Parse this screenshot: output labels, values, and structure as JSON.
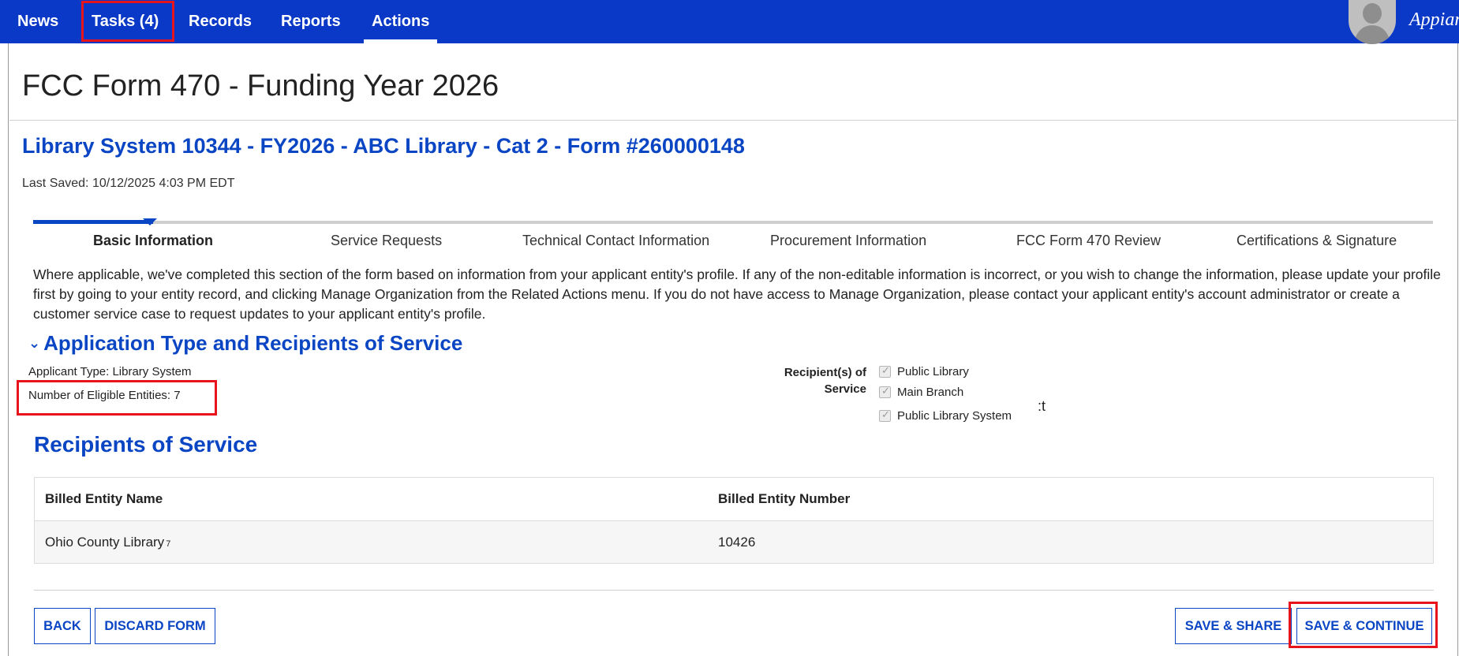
{
  "nav": {
    "items": [
      {
        "label": "News"
      },
      {
        "label": "Tasks (4)"
      },
      {
        "label": "Records"
      },
      {
        "label": "Reports"
      },
      {
        "label": "Actions"
      }
    ],
    "brand": "Appian"
  },
  "page": {
    "title": "FCC Form 470 - Funding Year 2026",
    "subtitle": "Library System 10344 - FY2026 - ABC Library - Cat 2 - Form #260000148",
    "last_saved": "Last Saved: 10/12/2025 4:03 PM EDT"
  },
  "steps": [
    {
      "label": "Basic Information"
    },
    {
      "label": "Service Requests"
    },
    {
      "label": "Technical Contact Information"
    },
    {
      "label": "Procurement Information"
    },
    {
      "label": "FCC Form 470 Review"
    },
    {
      "label": "Certifications & Signature"
    }
  ],
  "intro": "Where applicable, we've completed this section of the form based on information from your applicant entity's profile.  If any of the non-editable information is incorrect, or you wish to change the information, please update your profile first by going to your entity record, and clicking Manage Organization from the Related Actions menu.  If you do not have access to Manage Organization, please contact your applicant entity's account administrator or create a customer service case to request updates to your applicant entity's profile.",
  "application_section": {
    "chevron": "⌄",
    "title": "Application Type and Recipients of Service",
    "applicant_type": "Applicant Type: Library System",
    "eligible_entities": "Number of Eligible Entities: 7",
    "recipients_label": "Recipient(s) of Service",
    "recipients": [
      {
        "label": "Public Library",
        "checked": true
      },
      {
        "label": "Main Branch",
        "checked": true
      },
      {
        "label": "Public Library System",
        "checked": true
      }
    ],
    "stray_text": ":t"
  },
  "recipients_table": {
    "title": "Recipients of Service",
    "columns": [
      "Billed Entity Name",
      "Billed Entity Number"
    ],
    "rows": [
      {
        "name": "Ohio County Library",
        "name_marker": "7",
        "number": "10426"
      }
    ]
  },
  "buttons": {
    "back": "BACK",
    "discard": "DISCARD FORM",
    "save_share": "SAVE & SHARE",
    "save_continue": "SAVE & CONTINUE"
  },
  "colors": {
    "nav_bg": "#0a38c7",
    "accent_blue": "#0a45c4",
    "highlight_red": "#e8141c"
  }
}
